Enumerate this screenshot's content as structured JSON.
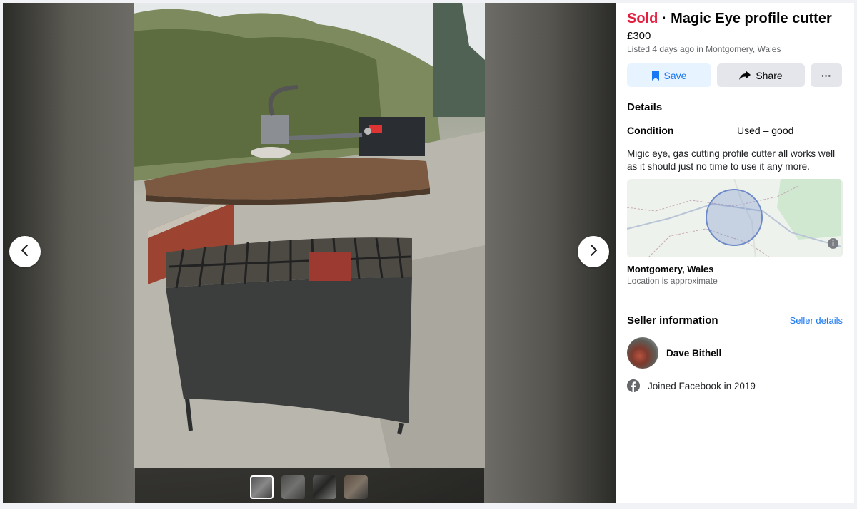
{
  "listing": {
    "sold_label": "Sold",
    "separator": " · ",
    "title": "Magic Eye profile cutter",
    "price": "£300",
    "listed_meta": "Listed 4 days ago in Montgomery, Wales"
  },
  "actions": {
    "save_label": "Save",
    "share_label": "Share",
    "more_label": "···"
  },
  "details": {
    "heading": "Details",
    "condition_key": "Condition",
    "condition_value": "Used – good",
    "description": "Migic eye, gas cutting profile cutter all works well as it should just no time to use it any more."
  },
  "location": {
    "name": "Montgomery, Wales",
    "note": "Location is approximate",
    "info_glyph": "i"
  },
  "seller": {
    "heading": "Seller information",
    "details_link": "Seller details",
    "name": "Dave Bithell",
    "joined": "Joined Facebook in 2019"
  },
  "gallery": {
    "thumbnail_count": 4,
    "active_index": 0
  },
  "colors": {
    "sold": "#e41e3f",
    "accent": "#1877f2"
  }
}
